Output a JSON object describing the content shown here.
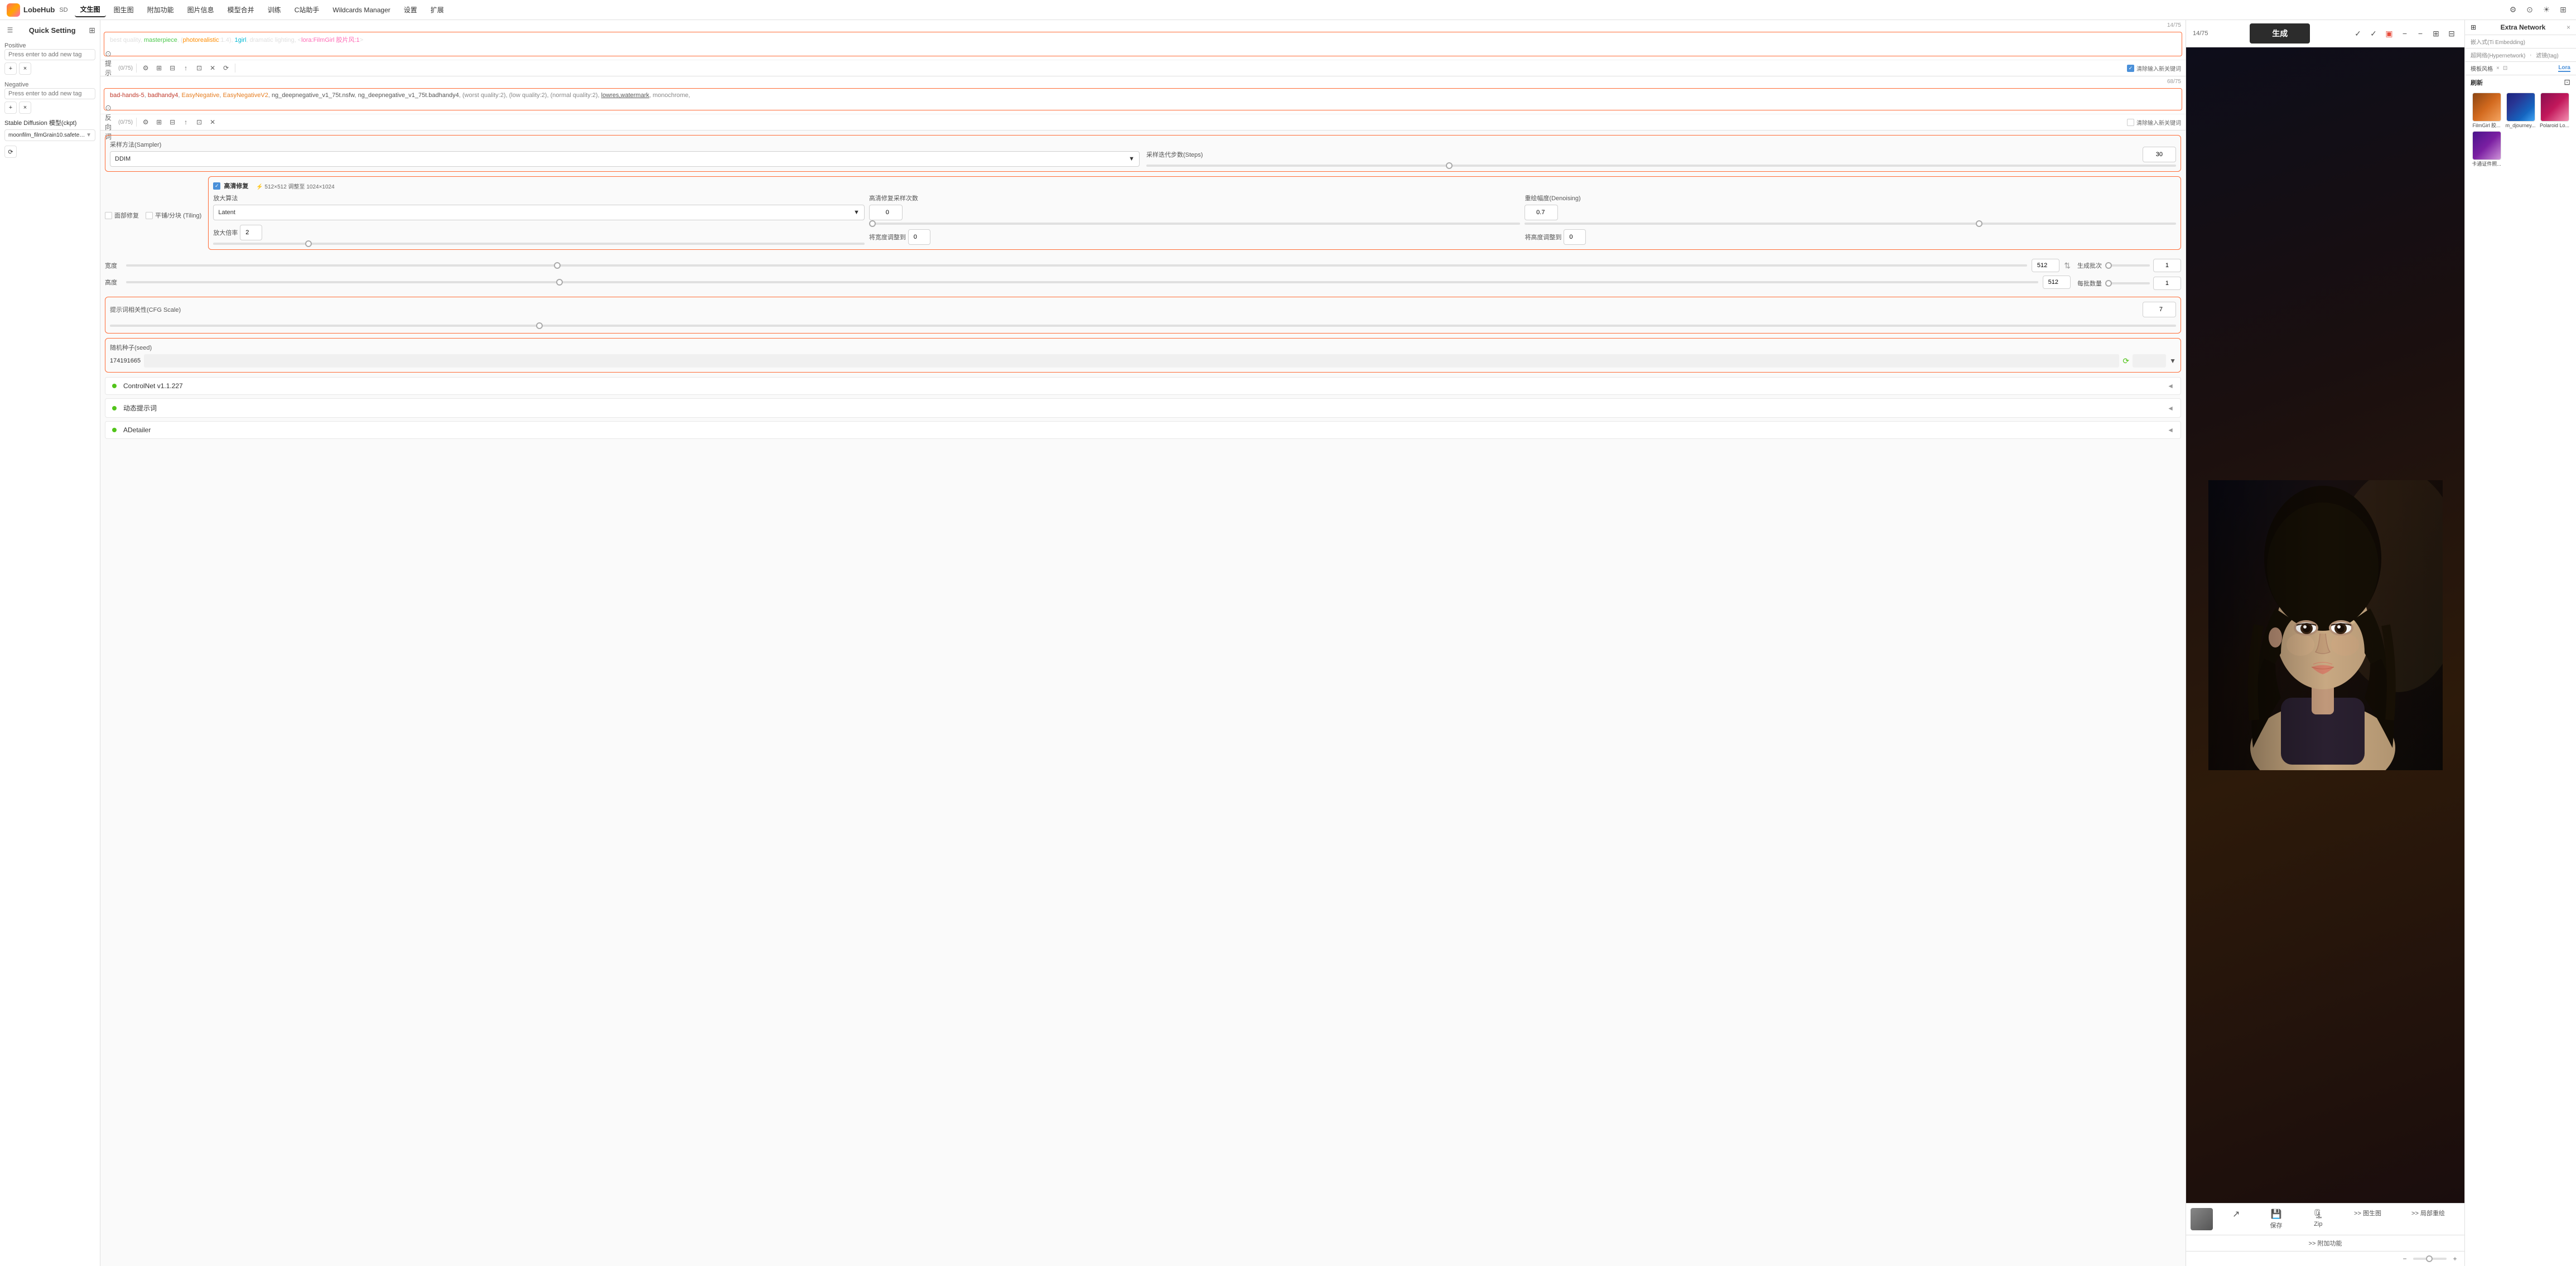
{
  "app": {
    "name": "LobeHub",
    "mode": "SD",
    "nav_items": [
      "文生图",
      "图生图",
      "附加功能",
      "图片信息",
      "模型合并",
      "训练",
      "C站助手",
      "Wildcards Manager",
      "设置",
      "扩展"
    ],
    "active_nav": "文生图"
  },
  "sidebar": {
    "title": "Quick Setting",
    "positive_label": "Positive",
    "positive_placeholder": "Press enter to add new tag",
    "negative_label": "Negative",
    "negative_placeholder": "Press enter to add new tag",
    "model_label": "Stable Diffusion 模型(ckpt)",
    "model_value": "moonfilm_filmGrain10.safetens..."
  },
  "positive_prompt": {
    "counter": "14/75",
    "text_parts": [
      {
        "text": "best quality",
        "color": "white"
      },
      {
        "text": ", ",
        "color": "white"
      },
      {
        "text": "masterpiece",
        "color": "green"
      },
      {
        "text": ", (",
        "color": "white"
      },
      {
        "text": "photorealistic",
        "color": "orange"
      },
      {
        "text": ":1.4), ",
        "color": "white"
      },
      {
        "text": "1girl",
        "color": "cyan"
      },
      {
        "text": ", ",
        "color": "white"
      },
      {
        "text": "dramatic lighting",
        "color": "white"
      },
      {
        "text": ", <",
        "color": "white"
      },
      {
        "text": "lora:FilmGirl 胶片风:1>",
        "color": "pink"
      }
    ],
    "toolbar": {
      "icons": [
        "⊙",
        "⚙",
        "⊞",
        "⊟",
        "↗",
        "✕",
        "⟳"
      ],
      "clear_label": "清除输入新关键词"
    }
  },
  "negative_prompt": {
    "counter": "68/75",
    "text": "bad-hands-5, badhandy4, EasyNegative, EasyNegativeV2, ng_deepnegative_v1_75t.nsfw, ng_deepnegative_v1_75t.badhandy4, (worst quality:2), (low quality:2), (normal quality:2), lowres,watermark, monochrome,",
    "toolbar": {
      "icons": [
        "⊙",
        "⚙",
        "⊞",
        "⊟",
        "↗",
        "✕"
      ],
      "clear_label": "清除输入新关键词"
    }
  },
  "sampler": {
    "label": "采样方法(Sampler)",
    "value": "DDIM",
    "steps_label": "采样迭代步数(Steps)",
    "steps_value": "30",
    "steps_slider_pct": 30
  },
  "hires": {
    "enabled": true,
    "label": "高清修复",
    "info": "⚡ 512×512 调整至 1024×1024",
    "upscaler_label": "放大算法",
    "upscaler_value": "Latent",
    "steps_label": "高清修复采样次数",
    "steps_value": "0",
    "denoising_label": "重绘幅度(Denoising)",
    "denoising_value": "0.7",
    "scale_label": "放大倍率",
    "scale_value": "2",
    "width_label": "将宽度调整到",
    "width_value": "0",
    "height_label": "将高度调整到",
    "height_value": "0"
  },
  "tiling": {
    "face_restore_label": "面部修复",
    "tiling_label": "平铺/分块 (Tiling)"
  },
  "dimensions": {
    "width_label": "宽度",
    "width_value": "512",
    "height_label": "高度",
    "height_value": "512",
    "batch_count_label": "生成批次",
    "batch_count_value": "1",
    "batch_size_label": "每批数量",
    "batch_size_value": "1"
  },
  "cfg": {
    "label": "提示词相关性(CFG Scale)",
    "value": "7",
    "slider_pct": 35
  },
  "seed": {
    "label": "随机种子(seed)",
    "value": "174191665"
  },
  "generate": {
    "button_label": "生成",
    "counter": "14/75"
  },
  "extra_network": {
    "title": "Extra Network",
    "tabs": [
      "嵌入式(Ti Embedding)",
      "超网络(Hypernetwork)",
      "滤镜(tag)",
      "Lora"
    ],
    "active_tab": "Lora",
    "template_label": "模板风格",
    "refresh_label": "刷新",
    "loras": [
      {
        "name": "FilmGirl 胶...",
        "color": "brown"
      },
      {
        "name": "m_djourney...",
        "color": "blue"
      },
      {
        "name": "Polaroid Lo...",
        "color": "pink"
      },
      {
        "name": "卡通证件照...",
        "color": "purple"
      }
    ]
  },
  "collapsible": [
    {
      "label": "ControlNet v1.1.227",
      "active": true
    },
    {
      "label": "动态提示词",
      "active": true
    },
    {
      "label": "ADetailer",
      "active": true
    }
  ],
  "image_actions": [
    {
      "label": "保存",
      "icon": "💾"
    },
    {
      "label": "Zip",
      "icon": "🗜"
    },
    {
      "label": ">> 图生图",
      "icon": "→"
    },
    {
      "label": ">> 局部重绘",
      "icon": "→"
    }
  ],
  "bottom_actions": [
    {
      "label": ">> 附加功能"
    }
  ]
}
